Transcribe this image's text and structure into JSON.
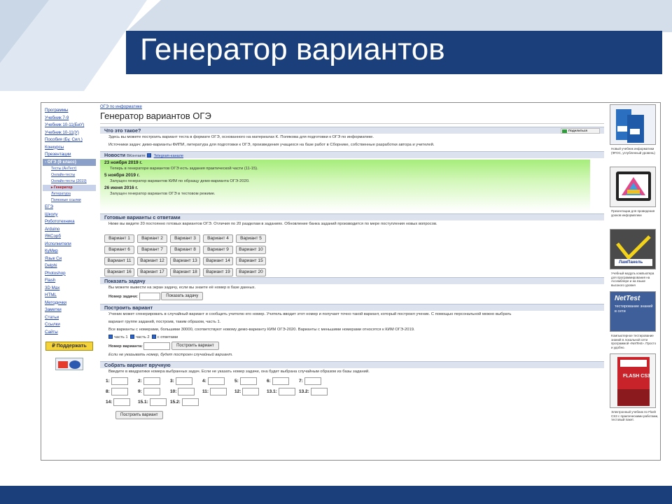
{
  "slide": {
    "title": "Генератор вариантов",
    "colors": {
      "title_bg": "#1b3f7a",
      "footer_bg": "#1b3f7a",
      "accent": "#8aa0c8"
    }
  },
  "nav": {
    "items": [
      "Программы",
      "Учебник 7-9",
      "Учебник 10-11(БиУ)",
      "Учебник 10-11(У)",
      "Пособия (Бу, Сил.)",
      "Конкурсы",
      "Презентации"
    ],
    "active_group": "ОГЭ (9 класс)",
    "sub_items": [
      "Тесты (АнТест)",
      "Онлайн-тесты",
      "Онлайн-тесты (2019)",
      "Генератор",
      "Литература",
      "Полезные ссылки"
    ],
    "selected_sub_index": 3,
    "items_after": [
      "ЕГЭ",
      "Школу",
      "Робототехника",
      "Arduino",
      "ЯКСорб",
      "Исполнители",
      "КуМир",
      "Язык Си",
      "Delphi",
      "Photoshop",
      "Flash",
      "3D Max",
      "HTML",
      "Методички",
      "Заметки",
      "Статьи",
      "Ссылки",
      "Сайты"
    ],
    "support_label": "₽ Поддержать"
  },
  "main": {
    "breadcrumb": "ОГЭ по информатике",
    "heading": "Генератор вариантов ОГЭ",
    "about": {
      "title": "Что это такое?",
      "share_label": "Поделиться",
      "line1": "Здесь вы можете построить вариант теста в формате ОГЭ, основанного на материалах К. Полякова для подготовки к ОГЭ по информатике.",
      "line2": "Источники задач: демо-варианты ФИПИ, литература для подготовки к ОГЭ, произведения учащихся на базе работ в Сборнике, собственные разработки автора и учителей."
    },
    "news": {
      "title": "Новости",
      "subscribe": "ВКонтакте",
      "telegram": "Telegram-канале",
      "entries": [
        {
          "date": "23 ноября 2019 г.",
          "text": "Теперь в генераторе вариантов ОГЭ есть задания практической части (11-15)."
        },
        {
          "date": "5 ноября 2019 г.",
          "text": "Запущен генератор вариантов КИМ по образцу демо-варианта ОГЭ-2020."
        },
        {
          "date": "26 июня 2016 г.",
          "text": "Запущен генератор вариантов ОГЭ в тестовом режиме."
        }
      ]
    },
    "ready": {
      "title": "Готовые варианты с ответами",
      "intro": "Ниже вы видите 20 постоянно готовых вариантов ОГЭ. Отличия по 20 разделам в заданиях. Обновление банка заданий производится по мере поступления новых вопросов.",
      "variants": [
        "Вариант 1",
        "Вариант 2",
        "Вариант 3",
        "Вариант 4",
        "Вариант 5",
        "Вариант 6",
        "Вариант 7",
        "Вариант 8",
        "Вариант 9",
        "Вариант 10",
        "Вариант 11",
        "Вариант 12",
        "Вариант 13",
        "Вариант 14",
        "Вариант 15",
        "Вариант 16",
        "Вариант 17",
        "Вариант 18",
        "Вариант 19",
        "Вариант 20"
      ]
    },
    "show_task": {
      "title": "Показать задачу",
      "hint": "Вы можете вывести на экран задачу, если вы знаете её номер в базе данных.",
      "label": "Номер задачи:",
      "button": "Показать задачу"
    },
    "build": {
      "title": "Построить вариант",
      "line1": "Ученик может сгенерировать в случайный вариант и сообщить учителю его номер. Учитель вводит этот номер и получает точно такой вариант, который построил ученик. С помощью персональной можно выбрать",
      "line2": "вариант группе заданий, построив, таким образом, часть 1.",
      "line3": "Все варианты с номерами, большими 30000, соответствуют новому демо-варианту КИМ ОГЭ-2020. Варианты с меньшими номерами относятся к КИМ ОГЭ-2019.",
      "checks": [
        "часть 1",
        "часть 2",
        "с ответами"
      ],
      "label": "Номер варианта:",
      "button": "Построить вариант",
      "note": "Если не указывать номер, будет построен случайный вариант."
    },
    "manual": {
      "title": "Собрать вариант вручную",
      "hint": "Введите в квадратики номера выбранных задач. Если не указать номер задачи, она будет выбрана случайным образом из базы заданий.",
      "rows": [
        [
          "1:",
          "2:",
          "3:",
          "4:",
          "5:",
          "6:",
          "7:"
        ],
        [
          "8:",
          "9:",
          "10:",
          "11:",
          "12:",
          "13.1:",
          "13.2:"
        ],
        [
          "14:",
          "15.1:",
          "15.2:"
        ]
      ],
      "button": "Построить вариант"
    }
  },
  "right": {
    "cards": [
      {
        "caption": "Новый учебник информатики (ФГОС, углубленный уровень)"
      },
      {
        "caption": "Презентации для проведения уроков информатики"
      },
      {
        "caption": "Учебный модуль компьютера для программирования на Ассемблере и на языке высокого уровня"
      },
      {
        "caption": "Компьютерное тестирование знаний в локальной сети программой «NetTest». Просто и удобно."
      },
      {
        "caption": "Электронный учебник по Flash CS3 с практическими работами, тестовый пакет."
      }
    ],
    "brands": [
      "ЛамПанель",
      "NetTest",
      "тестирование знаний в сети",
      "FLASH CS3"
    ]
  }
}
